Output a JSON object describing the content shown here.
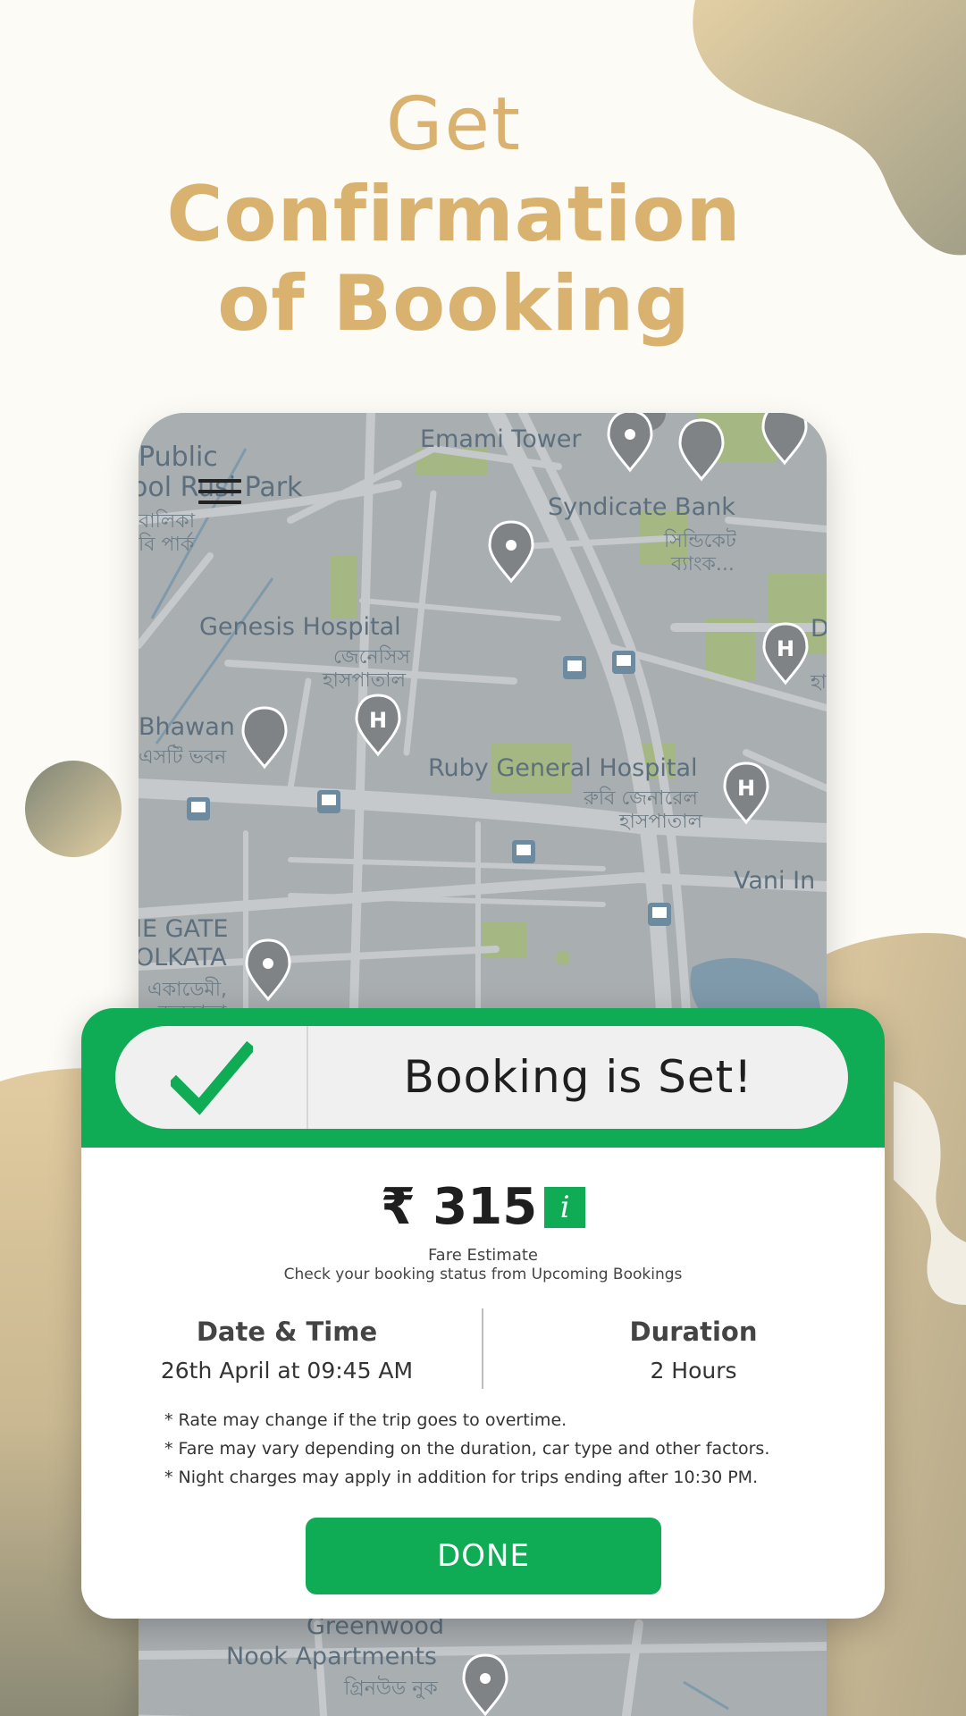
{
  "headline": {
    "line1": "Get",
    "line2": "Confirmation",
    "line3": "of Booking"
  },
  "map": {
    "labels": {
      "public_school": "Public",
      "rusi_park": "ool Rusi Park",
      "bn_balika": "বালিকা",
      "bn_park": "বি পার্ক",
      "emami_tower": "Emami Tower",
      "syndicate_bank": "Syndicate Bank",
      "syndicate_bn1": "সিন্ডিকেট",
      "syndicate_bn2": "ব্যাংক...",
      "genesis": "Genesis Hospital",
      "genesis_bn1": "জেনেসিস",
      "genesis_bn2": "হাসপাতাল",
      "bhawan": "Bhawan",
      "bhawan_bn": "এসটি ভবন",
      "ruby": "Ruby General Hospital",
      "ruby_bn1": "রুবি জেনারেল",
      "ruby_bn2": "হাসপাতাল",
      "vani": "Vani In",
      "gate": "IE GATE",
      "kolkata": "OLKATA",
      "academy_bn": "একাডেমী,",
      "kolkata_bn": "কলকাতা",
      "greenwood": "Greenwood",
      "nook": "Nook Apartments",
      "greenwood_bn": "গ্রিনউড নুক",
      "d_partial": "D",
      "hospital_partial_bn": "হা"
    }
  },
  "booking": {
    "status_title": "Booking is Set!",
    "price": "₹ 315",
    "info_glyph": "i",
    "fare_label": "Fare Estimate",
    "fare_sub": "Check your booking status from Upcoming Bookings",
    "date_time_title": "Date & Time",
    "date_time_value": "26th April at 09:45 AM",
    "duration_title": "Duration",
    "duration_value": "2 Hours",
    "notes": [
      "* Rate may change if the trip goes to overtime.",
      "* Fare may vary depending on the duration, car type and other factors.",
      "* Night charges may apply in addition for trips ending after 10:30 PM."
    ],
    "done_label": "DONE"
  },
  "colors": {
    "accent_green": "#10ab55",
    "headline_gold": "#d9b270",
    "background": "#fcfbf6"
  }
}
